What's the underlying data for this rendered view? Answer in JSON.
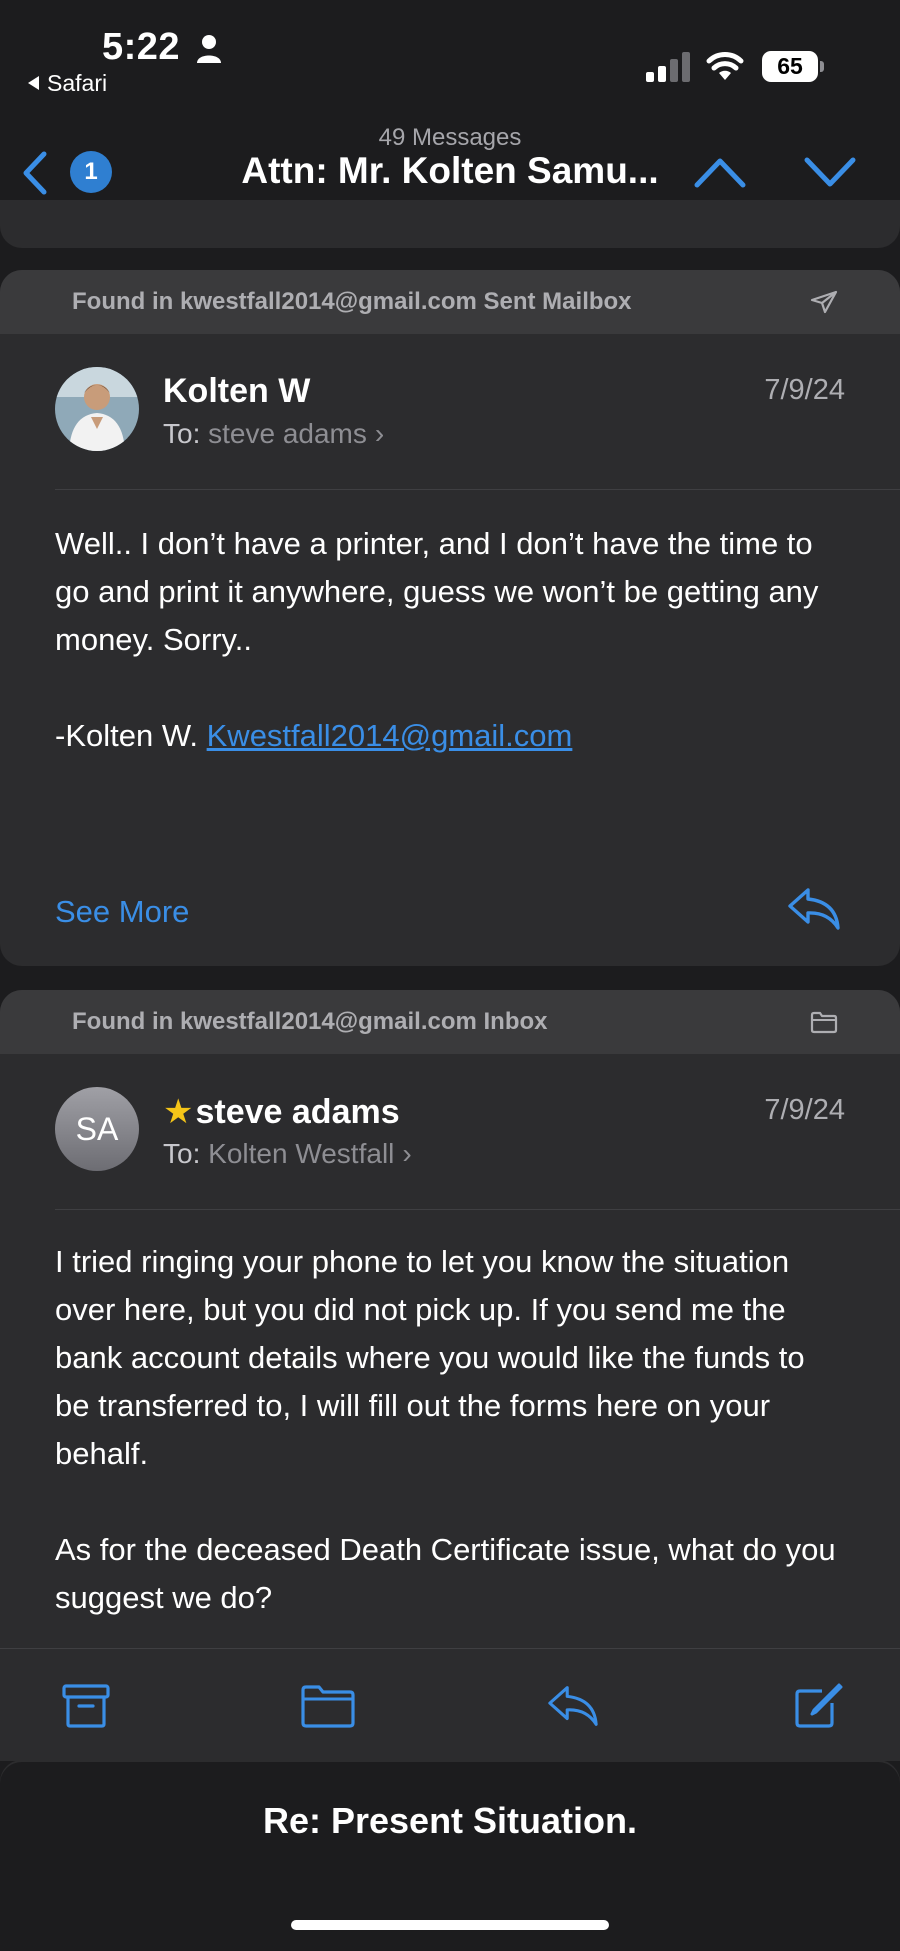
{
  "status_bar": {
    "time": "5:22",
    "back_app": "Safari",
    "battery": "65"
  },
  "nav": {
    "unread_badge": "1",
    "message_count": "49 Messages",
    "title": "Attn: Mr. Kolten Samu..."
  },
  "messages": [
    {
      "found_in": "Found in kwestfall2014@gmail.com Sent Mailbox",
      "folder_icon": "paper-plane-icon",
      "sender": "Kolten W",
      "to_label": "To:",
      "recipient": "steve adams",
      "date": "7/9/24",
      "body_paragraph_1": "Well.. I don’t have a printer, and I don’t have the time to go and print it anywhere, guess we won’t be getting any money. Sorry..",
      "signature": "-Kolten W.",
      "signature_link": "Kwestfall2014@gmail.com",
      "see_more": "See More"
    },
    {
      "found_in": "Found in kwestfall2014@gmail.com Inbox",
      "folder_icon": "folder-icon",
      "sender": "steve adams",
      "starred": true,
      "avatar_initials": "SA",
      "to_label": "To:",
      "recipient": "Kolten Westfall",
      "date": "7/9/24",
      "body_paragraph_1": "I tried ringing your phone to let you know the situation over here, but you did not pick up. If you send me the bank account details where you would like the funds to be transferred to, I will fill out the forms here on your behalf.",
      "body_paragraph_2": "As for the deceased Death Certificate issue, what do you suggest we do?"
    }
  ],
  "toolbar": {
    "icons": [
      "archive-icon",
      "folder-icon",
      "reply-icon",
      "compose-icon"
    ]
  },
  "bottom": {
    "subject": "Re: Present Situation."
  },
  "colors": {
    "background": "#1c1c1e",
    "card": "#2c2c2e",
    "accent": "#3a8ee6",
    "star": "#f5c518"
  }
}
